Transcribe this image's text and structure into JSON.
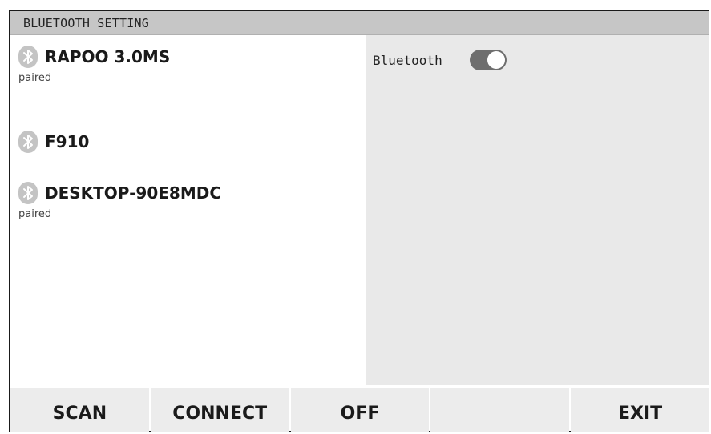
{
  "window": {
    "title": "BLUETOOTH SETTING"
  },
  "devices": [
    {
      "name": "RAPOO 3.0MS",
      "status": "paired",
      "icon": "bluetooth-icon"
    },
    {
      "name": "F910",
      "status": "",
      "icon": "bluetooth-icon"
    },
    {
      "name": "DESKTOP-90E8MDC",
      "status": "paired",
      "icon": "bluetooth-icon"
    }
  ],
  "settings": {
    "bluetooth_label": "Bluetooth",
    "bluetooth_enabled": true
  },
  "buttons": {
    "scan": "SCAN",
    "connect": "CONNECT",
    "off": "OFF",
    "blank": "",
    "exit": "EXIT"
  },
  "colors": {
    "title_bar": "#c6c6c6",
    "panel_bg": "#e9e9e9",
    "button_bg": "#ececec",
    "toggle_on": "#6e6e6e"
  }
}
